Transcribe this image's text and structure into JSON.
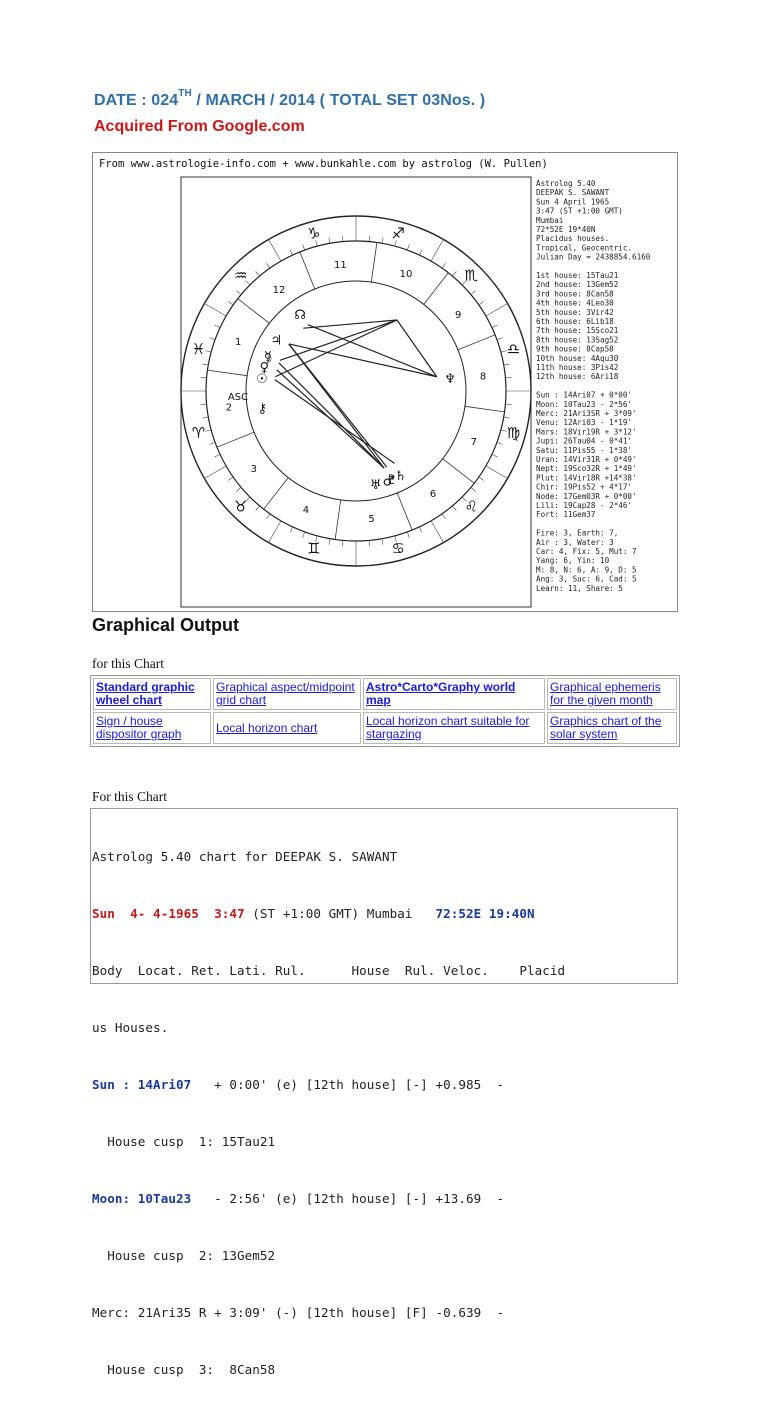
{
  "header": {
    "date_prefix": "DATE : 024",
    "date_sup": "TH",
    "date_suffix": " / MARCH / 2014 ( TOTAL SET 03Nos. )",
    "acquired": "Acquired From Google.com"
  },
  "chart_image": {
    "caption": "From www.astrologie-info.com    +    www.bunkahle.com by astrolog (W. Pullen)",
    "info_lines": [
      "Astrolog 5.40",
      "DEEPAK S. SAWANT",
      "Sun 4 April 1965",
      " 3:47 (ST +1:00 GMT)",
      "Mumbai",
      " 72*52E 19*40N",
      "Placidus houses.",
      "Tropical, Geocentric.",
      "Julian Day = 2438854.6160"
    ],
    "house_lines": [
      "1st house: 15Tau21",
      "2nd house: 13Gem52",
      "3rd house:  8Can58",
      "4th house:  4Leo30",
      "5th house:  3Vir42",
      "6th house:  6Lib18",
      "7th house: 15Sco21",
      "8th house: 13Sag52",
      "9th house:  8Cap58",
      "10th house:  4Aqu30",
      "11th house:  3Pis42",
      "12th house:  6Ari18"
    ],
    "planet_lines": [
      "Sun : 14Ari07  + 0*00'",
      "Moon: 10Tau23  - 2*56'",
      "Merc: 21Ari3SR + 3*09'",
      "Venu: 12Ari03  - 1*19'",
      "Mars: 18Vir19R + 3*12'",
      "Jupi: 26Tau04  - 0*41'",
      "Satu: 11Pis55  - 1*38'",
      "Uran: 14Vir31R + 0*49'",
      "Nept: 19Sco32R + 1*49'",
      "Plut: 14Vir18R +14*38'",
      "Chir: 19Pis52  + 4*17'",
      "Node: 17Gem03R + 0*00'",
      "Lili: 19Cap28  - 2*46'",
      "Fort: 11Gem37"
    ],
    "element_lines": [
      "Fire: 3, Earth: 7,",
      "Air : 3, Water: 3",
      "Car: 4, Fix: 5, Mut: 7",
      "Yang: 6, Yin: 10",
      "M: 8, N: 6, A: 9, D: 5",
      "Ang: 3, Suc: 6, Cad: 5",
      "Learn: 11, Share: 5"
    ],
    "house_numbers": [
      "1",
      "2",
      "3",
      "4",
      "5",
      "6",
      "7",
      "8",
      "9",
      "10",
      "11",
      "12"
    ],
    "asc_label": "ASC"
  },
  "graphical": {
    "title": "Graphical Output",
    "for_chart": "for this Chart",
    "rows": [
      [
        {
          "text": "Standard graphic wheel chart",
          "bold": true
        },
        {
          "text": "Graphical aspect/midpoint grid chart",
          "bold": false
        },
        {
          "text": "Astro*Carto*Graphy world map",
          "bold": true
        },
        {
          "text": "Graphical ephemeris for the given month",
          "bold": false
        }
      ],
      [
        {
          "text": "Sign / house dispositor graph",
          "bold": false
        },
        {
          "text": "Local horizon chart",
          "bold": false
        },
        {
          "text": "Local horizon chart suitable for stargazing",
          "bold": false
        },
        {
          "text": "Graphics chart of the solar system",
          "bold": false
        }
      ]
    ]
  },
  "text_chart": {
    "for_chart": "For this Chart",
    "line1": "Astrolog 5.40 chart for DEEPAK S. SAWANT",
    "line2_a": "Sun  4- 4-1965  3:47",
    "line2_b": " (ST +1:00 GMT) Mumbai   ",
    "line2_c": "72:52E 19:40N",
    "line3": "Body  Locat. Ret. Lati. Rul.      House  Rul. Veloc.    Placid",
    "line4": "us Houses.",
    "line5_a": "Sun : 14Ari07",
    "line5_b": "   + 0:00' (e) [12th house] [-] +0.985  -",
    "line6": "  House cusp  1: 15Tau21",
    "line7_a": "Moon: 10Tau23",
    "line7_b": "   - 2:56' (e) [12th house] [-] +13.69  -",
    "line8": "  House cusp  2: 13Gem52",
    "line9": "Merc: 21Ari35 R + 3:09' (-) [12th house] [F] -0.639  -",
    "line10": "  House cusp  3:  8Can58"
  }
}
